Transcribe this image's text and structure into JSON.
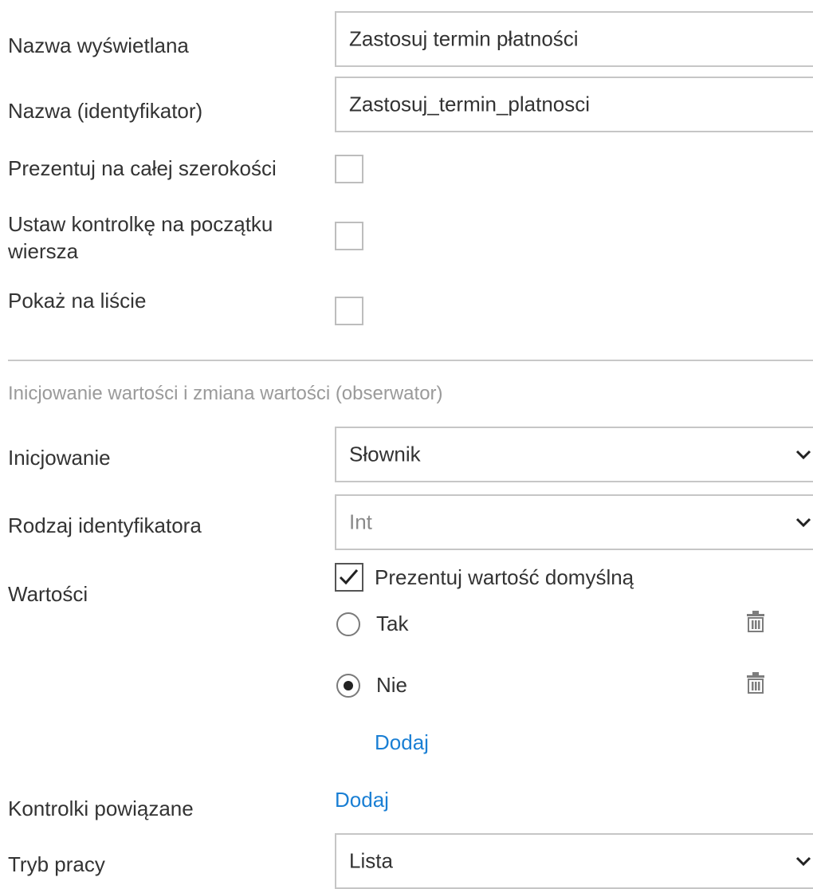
{
  "colors": {
    "link": "#1a7fd4",
    "section_title": "#9a9a9a",
    "border": "#c6c6c6",
    "text": "#333333"
  },
  "general": {
    "display_name_label": "Nazwa wyświetlana",
    "display_name_value": "Zastosuj termin płatności",
    "identifier_label": "Nazwa (identyfikator)",
    "identifier_value": "Zastosuj_termin_platnosci",
    "full_width_label": "Prezentuj na całej szerokości",
    "full_width_checked": false,
    "row_start_label": "Ustaw kontrolkę na początku wiersza",
    "row_start_checked": false,
    "show_on_list_label": "Pokaż na liście",
    "show_on_list_checked": false
  },
  "observer": {
    "section_title": "Inicjowanie wartości i zmiana wartości (obserwator)",
    "init_label": "Inicjowanie",
    "init_value": "Słownik",
    "id_type_label": "Rodzaj identyfikatora",
    "id_type_value": "Int",
    "values_label": "Wartości",
    "show_default_label": "Prezentuj wartość domyślną",
    "show_default_checked": true,
    "options": [
      {
        "label": "Tak",
        "selected": false,
        "delete_icon": "trash-icon"
      },
      {
        "label": "Nie",
        "selected": true,
        "delete_icon": "trash-icon"
      }
    ],
    "add_value_link": "Dodaj",
    "related_controls_label": "Kontrolki powiązane",
    "related_controls_add_link": "Dodaj",
    "mode_label": "Tryb pracy",
    "mode_value": "Lista"
  },
  "icons": {
    "dropdown": "chevron-down-icon",
    "check": "checkmark-icon",
    "delete": "trash-icon"
  }
}
